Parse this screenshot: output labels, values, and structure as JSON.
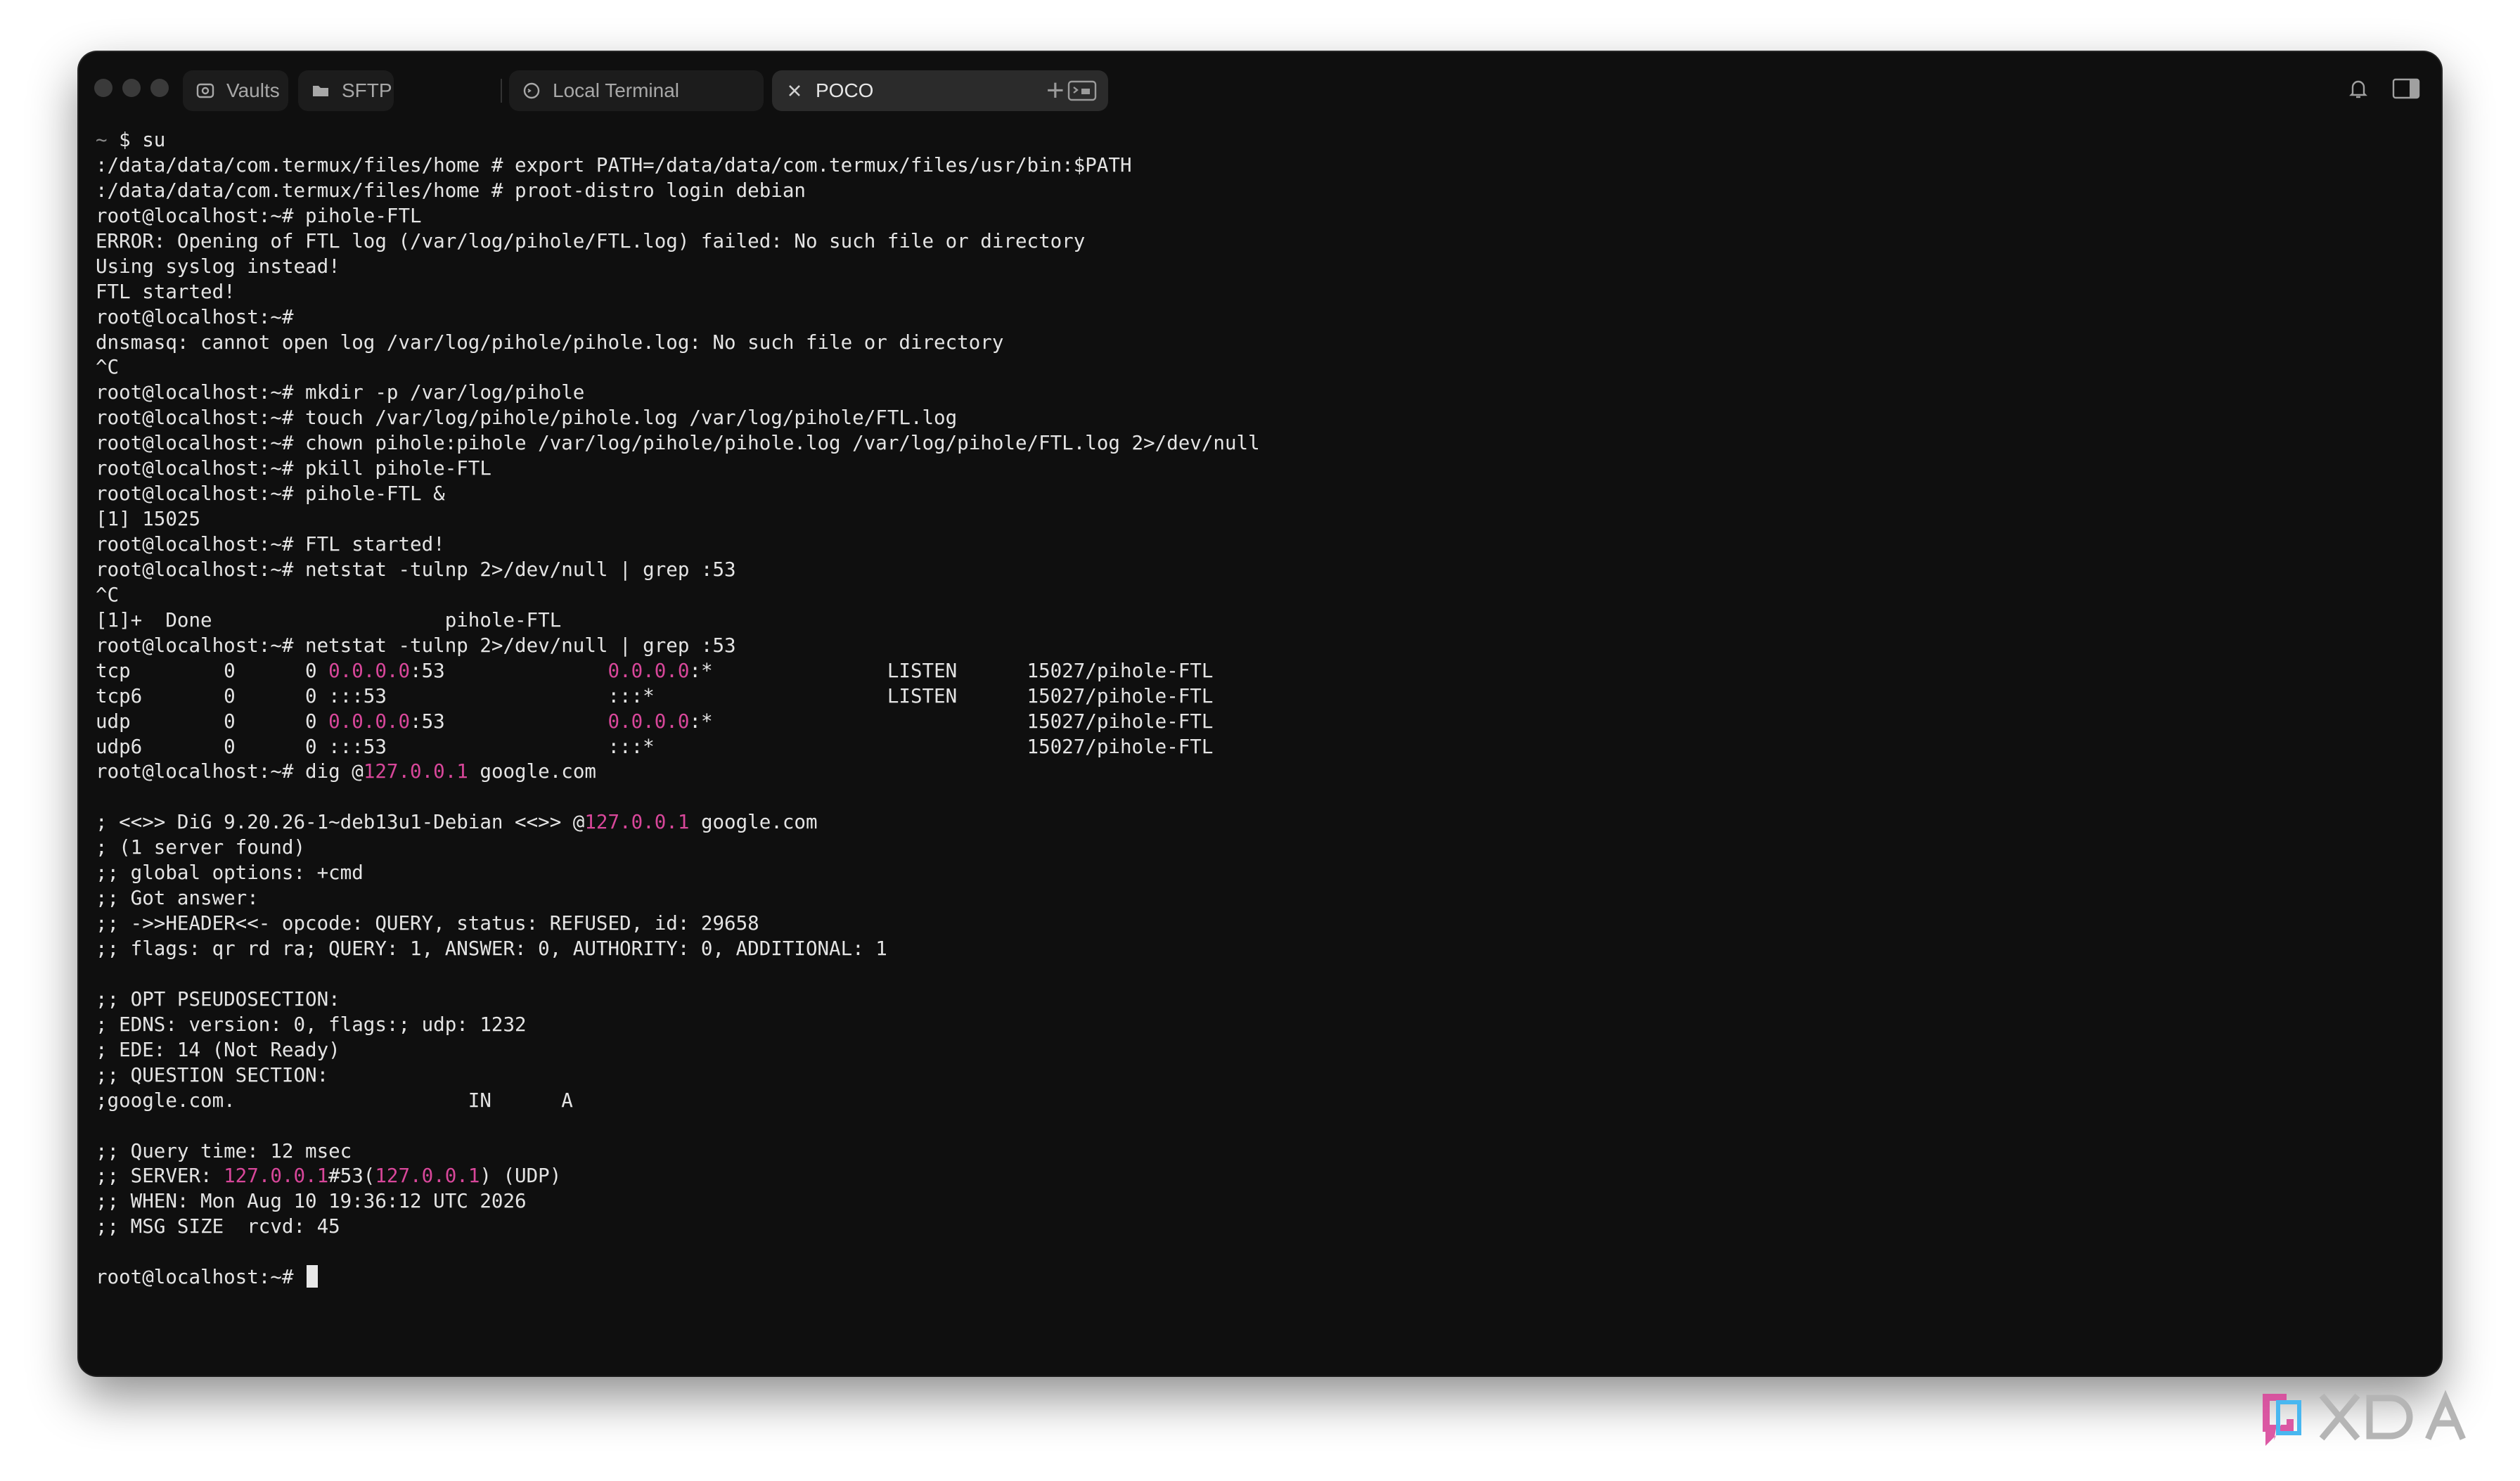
{
  "window": {
    "tabs": [
      {
        "label": "Vaults",
        "icon": "vault-icon"
      },
      {
        "label": "SFTP",
        "icon": "folder-icon"
      },
      {
        "label": "Local Terminal",
        "icon": "terminal-icon"
      },
      {
        "label": "POCO",
        "icon": "close-icon",
        "active": true
      }
    ],
    "new_tab": "+"
  },
  "terminal": {
    "lines": [
      [
        "",
        {
          "t": "~ ",
          "c": "dim"
        },
        {
          "t": "$ su"
        }
      ],
      [
        ":/data/data/com.termux/files/home # export PATH=/data/data/com.termux/files/usr/bin:$PATH"
      ],
      [
        ":/data/data/com.termux/files/home # proot-distro login debian"
      ],
      [
        "root@localhost:~# pihole-FTL"
      ],
      [
        "ERROR: Opening of FTL log (/var/log/pihole/FTL.log) failed: No such file or directory"
      ],
      [
        "Using syslog instead!"
      ],
      [
        "FTL started!"
      ],
      [
        "root@localhost:~#"
      ],
      [
        "dnsmasq: cannot open log /var/log/pihole/pihole.log: No such file or directory"
      ],
      [
        "^C"
      ],
      [
        "root@localhost:~# mkdir -p /var/log/pihole"
      ],
      [
        "root@localhost:~# touch /var/log/pihole/pihole.log /var/log/pihole/FTL.log"
      ],
      [
        "root@localhost:~# chown pihole:pihole /var/log/pihole/pihole.log /var/log/pihole/FTL.log 2>/dev/null"
      ],
      [
        "root@localhost:~# pkill pihole-FTL"
      ],
      [
        "root@localhost:~# pihole-FTL &"
      ],
      [
        "[1] 15025"
      ],
      [
        "root@localhost:~# FTL started!"
      ],
      [
        "root@localhost:~# netstat -tulnp 2>/dev/null | grep :53"
      ],
      [
        "^C"
      ],
      [
        "[1]+  Done                    pihole-FTL"
      ],
      [
        "root@localhost:~# netstat -tulnp 2>/dev/null | grep :53"
      ],
      [
        "",
        {
          "t": "tcp        0      0 "
        },
        {
          "t": "0.0.0.0",
          "c": "pk"
        },
        {
          "t": ":53              "
        },
        {
          "t": "0.0.0.0",
          "c": "pk"
        },
        {
          "t": ":*               LISTEN      15027/pihole-FTL"
        }
      ],
      [
        "tcp6       0      0 :::53                   :::*                    LISTEN      15027/pihole-FTL"
      ],
      [
        "",
        {
          "t": "udp        0      0 "
        },
        {
          "t": "0.0.0.0",
          "c": "pk"
        },
        {
          "t": ":53              "
        },
        {
          "t": "0.0.0.0",
          "c": "pk"
        },
        {
          "t": ":*                           15027/pihole-FTL"
        }
      ],
      [
        "udp6       0      0 :::53                   :::*                                15027/pihole-FTL"
      ],
      [
        "",
        {
          "t": "root@localhost:~# dig @"
        },
        {
          "t": "127.0.0.1",
          "c": "pk"
        },
        {
          "t": " google.com"
        }
      ],
      [
        ""
      ],
      [
        "",
        {
          "t": "; <<>> DiG 9.20.26-1~deb13u1-Debian <<>> @"
        },
        {
          "t": "127.0.0.1",
          "c": "pk"
        },
        {
          "t": " google.com"
        }
      ],
      [
        "; (1 server found)"
      ],
      [
        ";; global options: +cmd"
      ],
      [
        ";; Got answer:"
      ],
      [
        ";; ->>HEADER<<- opcode: QUERY, status: REFUSED, id: 29658"
      ],
      [
        ";; flags: qr rd ra; QUERY: 1, ANSWER: 0, AUTHORITY: 0, ADDITIONAL: 1"
      ],
      [
        ""
      ],
      [
        ";; OPT PSEUDOSECTION:"
      ],
      [
        "; EDNS: version: 0, flags:; udp: 1232"
      ],
      [
        "; EDE: 14 (Not Ready)"
      ],
      [
        ";; QUESTION SECTION:"
      ],
      [
        ";google.com.                    IN      A"
      ],
      [
        ""
      ],
      [
        ";; Query time: 12 msec"
      ],
      [
        "",
        {
          "t": ";; SERVER: "
        },
        {
          "t": "127.0.0.1",
          "c": "pk"
        },
        {
          "t": "#53("
        },
        {
          "t": "127.0.0.1",
          "c": "pk"
        },
        {
          "t": ") (UDP)"
        }
      ],
      [
        ";; WHEN: Mon Aug 10 19:36:12 UTC 2026"
      ],
      [
        ";; MSG SIZE  rcvd: 45"
      ],
      [
        ""
      ],
      [
        "root@localhost:~# "
      ]
    ]
  },
  "colors": {
    "background": "#0f0f0f",
    "text": "#e4e4e4",
    "ip_highlight": "#d8479a"
  }
}
